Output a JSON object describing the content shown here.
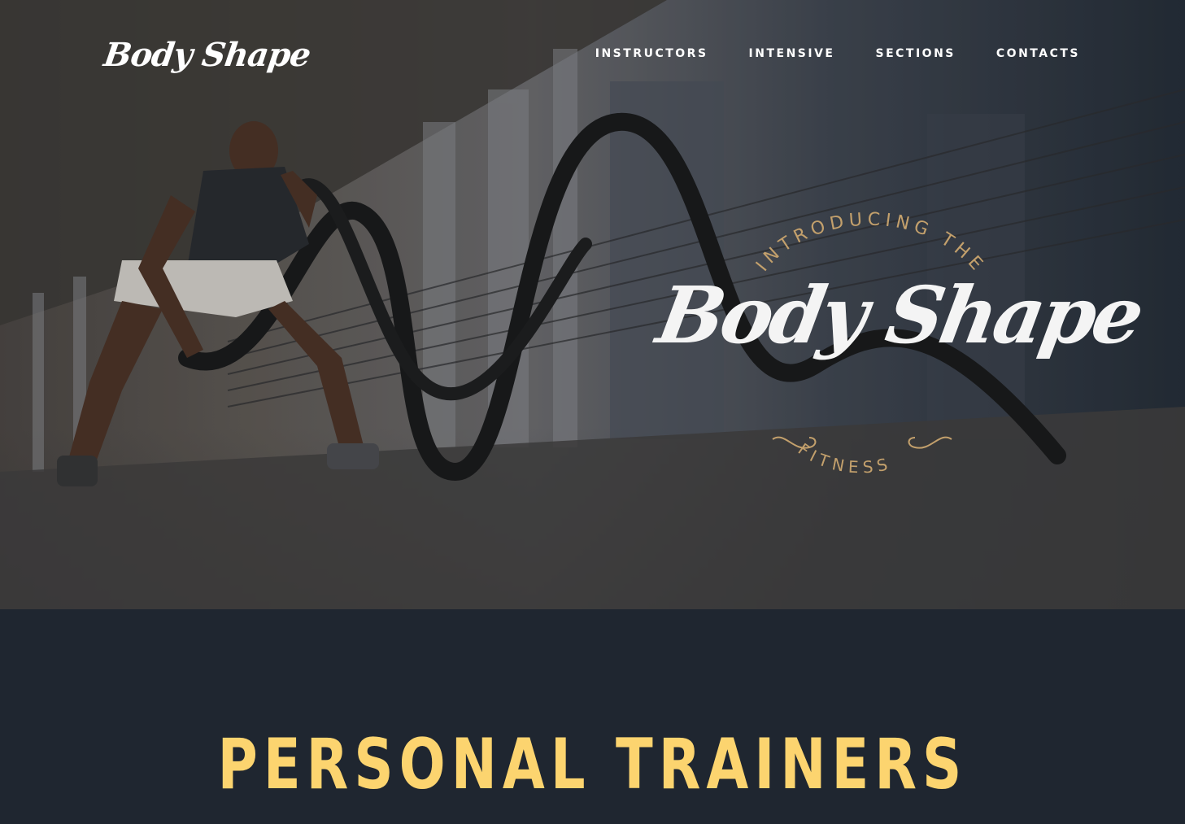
{
  "brand": {
    "logo_text": "Body Shape"
  },
  "nav": {
    "items": [
      "INSTRUCTORS",
      "INTENSIVE",
      "SECTIONS",
      "CONTACTS"
    ]
  },
  "hero": {
    "badge": {
      "top_text": "INTRODUCING THE",
      "script_text": "Body Shape",
      "bottom_text": "FITNESS"
    }
  },
  "section": {
    "heading": "PERSONAL TRAINERS"
  },
  "colors": {
    "accent": "#fcd46f",
    "badge_gold": "#c3a06c",
    "background": "#1f2630"
  }
}
